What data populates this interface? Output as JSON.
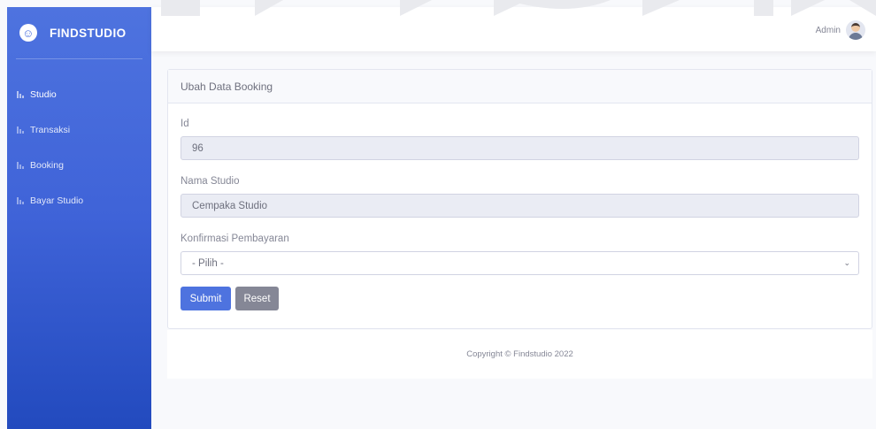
{
  "brand": {
    "name": "FINDSTUDIO",
    "icon": "smiley-icon"
  },
  "sidebar": {
    "items": [
      {
        "label": "Studio",
        "icon": "chart-bars-icon",
        "active": true
      },
      {
        "label": "Transaksi",
        "icon": "chart-bars-icon",
        "active": false
      },
      {
        "label": "Booking",
        "icon": "chart-bars-icon",
        "active": false
      },
      {
        "label": "Bayar Studio",
        "icon": "chart-bars-icon",
        "active": false
      }
    ]
  },
  "topbar": {
    "user_name": "Admin",
    "avatar_icon": "user-avatar-icon"
  },
  "card": {
    "title": "Ubah Data Booking",
    "fields": {
      "id": {
        "label": "Id",
        "value": "96"
      },
      "nama_studio": {
        "label": "Nama Studio",
        "value": "Cempaka Studio"
      },
      "konfirmasi": {
        "label": "Konfirmasi Pembayaran",
        "selected": "- Pilih -"
      }
    },
    "submit_label": "Submit",
    "reset_label": "Reset"
  },
  "footer": {
    "copyright": "Copyright © Findstudio 2022"
  },
  "colors": {
    "primary": "#4e73df",
    "secondary": "#858796",
    "sidebar_gradient_end": "#224abe"
  }
}
